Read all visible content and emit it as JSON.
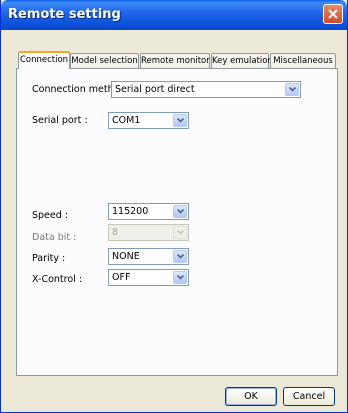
{
  "window": {
    "title": "Remote setting"
  },
  "tabs": [
    {
      "label": "Connection"
    },
    {
      "label": "Model selection"
    },
    {
      "label": "Remote monitor"
    },
    {
      "label": "Key emulation"
    },
    {
      "label": "Miscellaneous"
    }
  ],
  "connection": {
    "method_label": "Connection method :",
    "method_value": "Serial port direct",
    "serial_port_label": "Serial port :",
    "serial_port_value": "COM1",
    "speed_label": "Speed :",
    "speed_value": "115200",
    "data_bit_label": "Data bit :",
    "data_bit_value": "8",
    "parity_label": "Parity :",
    "parity_value": "NONE",
    "xcontrol_label": "X-Control :",
    "xcontrol_value": "OFF"
  },
  "buttons": {
    "ok": "OK",
    "cancel": "Cancel"
  },
  "colors": {
    "title_bar": "#0a5fe8",
    "tab_highlight": "#f5a623",
    "dialog_bg": "#ece9d8"
  }
}
